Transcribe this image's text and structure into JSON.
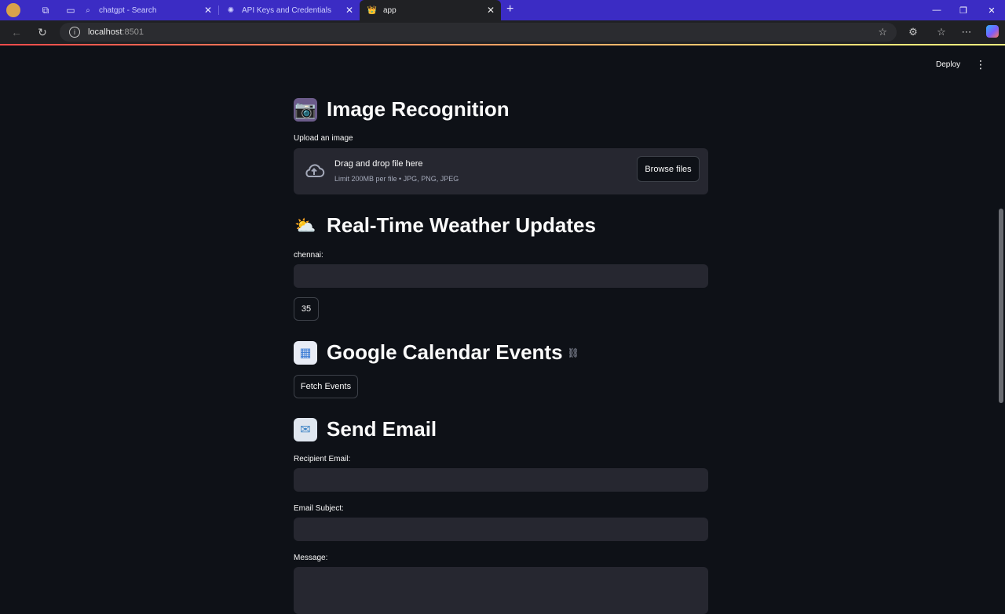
{
  "browser": {
    "tabs": [
      {
        "label": "chatgpt - Search",
        "favicon": "search-icon"
      },
      {
        "label": "API Keys and Credentials",
        "favicon": "openai-icon"
      },
      {
        "label": "app",
        "favicon": "streamlit-icon"
      }
    ],
    "address": {
      "host": "localhost",
      "port": ":8501"
    },
    "colors": {
      "tabbar": "#3b2cc4",
      "toolbar": "#202124"
    }
  },
  "app": {
    "toolbar": {
      "deploy_label": "Deploy"
    },
    "image_section": {
      "title": "Image Recognition",
      "icon": "camera-emoji",
      "upload_label": "Upload an image",
      "drop_text": "Drag and drop file here",
      "limit_text": "Limit 200MB per file • JPG, PNG, JPEG",
      "browse_label": "Browse files"
    },
    "weather_section": {
      "title": "Real-Time Weather Updates",
      "icon": "sun-behind-cloud-emoji",
      "city_label": "chennai:",
      "city_value": "",
      "temperature": "35"
    },
    "calendar_section": {
      "title": "Google Calendar Events",
      "icon": "calendar-emoji",
      "fetch_label": "Fetch Events"
    },
    "email_section": {
      "title": "Send Email",
      "icon": "email-emoji",
      "recipient_label": "Recipient Email:",
      "subject_label": "Email Subject:",
      "message_label": "Message:"
    },
    "colors": {
      "background": "#0e1117",
      "input": "#262730",
      "text": "#fafafa",
      "accent": "#ff4b4b"
    }
  }
}
